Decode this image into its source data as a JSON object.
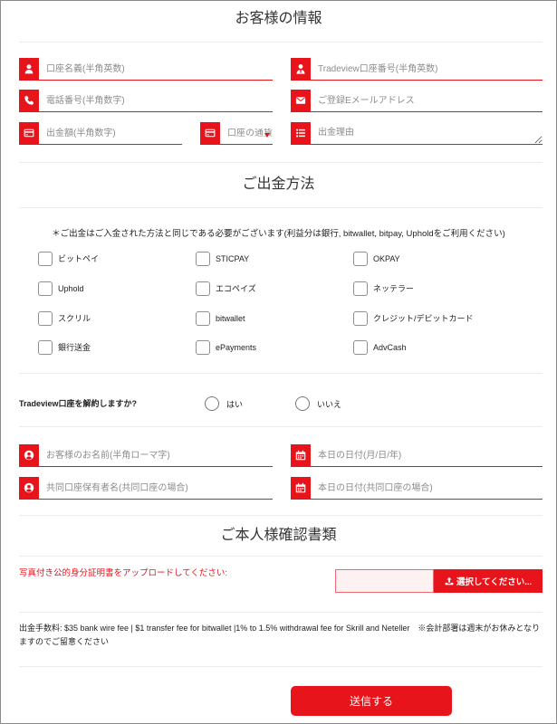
{
  "colors": {
    "accent": "#e8141c",
    "text": "#333333",
    "placeholder": "#8c8c8c",
    "divider": "#ececec",
    "upload_bg": "#fdf1f1"
  },
  "customer_info": {
    "heading": "お客様の情報",
    "account_name": {
      "placeholder": "口座名義(半角英数)",
      "value": "",
      "icon": "user-icon"
    },
    "account_number": {
      "placeholder": "Tradeview口座番号(半角英数)",
      "value": "",
      "icon": "user-tie-icon"
    },
    "phone": {
      "placeholder": "電話番号(半角数字)",
      "value": "",
      "icon": "phone-icon"
    },
    "email": {
      "placeholder": "ご登録Eメールアドレス",
      "value": "",
      "icon": "envelope-icon"
    },
    "amount": {
      "placeholder": "出金額(半角数字)",
      "value": "",
      "icon": "credit-card-icon"
    },
    "currency": {
      "selected": "口座の通貨",
      "icon": "credit-card-icon"
    },
    "reason": {
      "placeholder": "出金理由",
      "value": "",
      "icon": "list-icon"
    }
  },
  "withdrawal_method": {
    "heading": "ご出金方法",
    "note": "＊ご出金はご入金された方法と同じである必要がございます(利益分は銀行, bitwallet, bitpay, Upholdをご利用ください)",
    "options": [
      {
        "label": "ビットペイ",
        "checked": false
      },
      {
        "label": "STICPAY",
        "checked": false
      },
      {
        "label": "OKPAY",
        "checked": false
      },
      {
        "label": "Uphold",
        "checked": false
      },
      {
        "label": "エコペイズ",
        "checked": false
      },
      {
        "label": "ネッテラー",
        "checked": false
      },
      {
        "label": "スクリル",
        "checked": false
      },
      {
        "label": "bitwallet",
        "checked": false
      },
      {
        "label": "クレジット/デビットカード",
        "checked": false
      },
      {
        "label": "銀行送金",
        "checked": false
      },
      {
        "label": "ePayments",
        "checked": false
      },
      {
        "label": "AdvCash",
        "checked": false
      }
    ]
  },
  "close_account": {
    "question": "Tradeview口座を解約しますか?",
    "options": [
      {
        "label": "はい",
        "selected": false
      },
      {
        "label": "いいえ",
        "selected": false
      }
    ]
  },
  "signature": {
    "name": {
      "placeholder": "お客様のお名前(半角ローマ字)",
      "value": "",
      "icon": "user-circle-icon"
    },
    "date": {
      "placeholder": "本日の日付(月/日/年)",
      "value": "",
      "icon": "calendar-icon"
    },
    "joint_name": {
      "placeholder": "共同口座保有者名(共同口座の場合)",
      "value": "",
      "icon": "user-circle-icon"
    },
    "joint_date": {
      "placeholder": "本日の日付(共同口座の場合)",
      "value": "",
      "icon": "calendar-icon"
    }
  },
  "identity_documents": {
    "heading": "ご本人様確認書類",
    "upload_label": "写真付き公的身分証明書をアップロードしてください:",
    "file_value": "",
    "upload_button": "選択してください...",
    "upload_icon": "upload-icon"
  },
  "fee_note": "出金手数料: $35 bank wire fee | $1 transfer fee for bitwallet |1% to 1.5% withdrawal fee for Skrill and Neteller　※会計部署は週末がお休みとなりますのでご留意ください",
  "submit_label": "送信する"
}
